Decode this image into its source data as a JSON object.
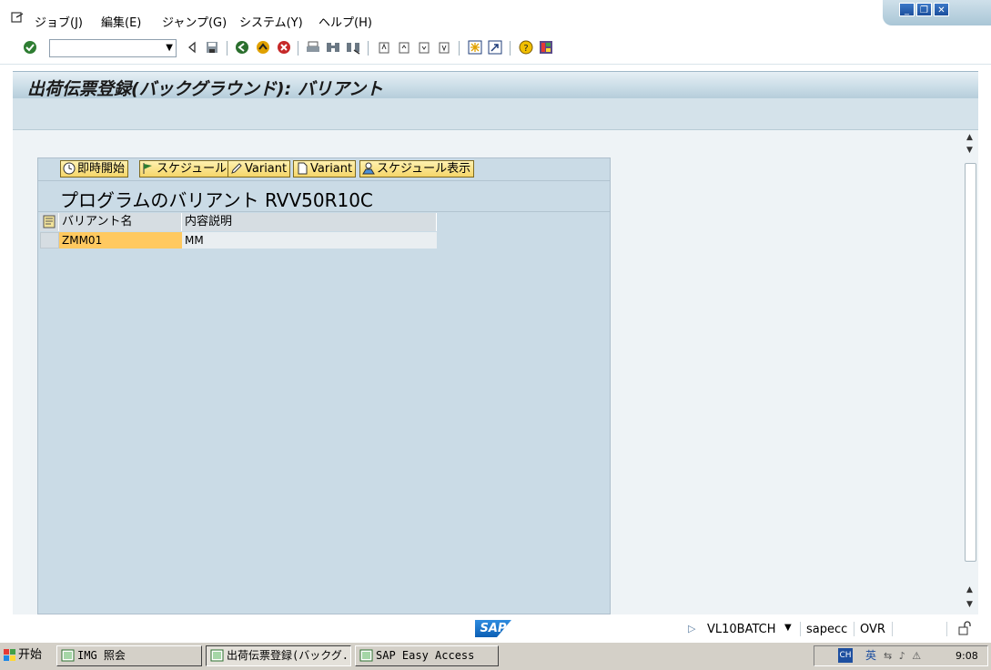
{
  "menu": {
    "items": [
      "ジョブ(J)",
      "編集(E)",
      "ジャンプ(G)",
      "システム(Y)",
      "ヘルプ(H)"
    ]
  },
  "toolbar": {
    "command_value": "",
    "icons": [
      "enter-icon",
      "back-icon",
      "save-icon",
      "green-back-icon",
      "exit-icon",
      "cancel-icon",
      "print-icon",
      "find-icon",
      "find-next-icon",
      "first-page-icon",
      "prev-page-icon",
      "next-page-icon",
      "last-page-icon",
      "new-session-icon",
      "shortcut-icon",
      "help-icon",
      "layout-icon"
    ]
  },
  "title": "出荷伝票登録(バックグラウンド): バリアント",
  "panel": {
    "buttons": [
      "即時開始",
      "スケジュール",
      "Variant",
      "Variant",
      "スケジュール表示"
    ],
    "heading": "プログラムのバリアント RVV50R10C",
    "table": {
      "columns": [
        "バリアント名",
        "内容説明"
      ],
      "rows": [
        {
          "name": "ZMM01",
          "description": "MM"
        }
      ]
    }
  },
  "status": {
    "logo": "SAP",
    "transaction": "VL10BATCH",
    "server": "sapecc",
    "mode": "OVR"
  },
  "taskbar": {
    "start": "开始",
    "tasks": [
      "IMG 照会",
      "出荷伝票登録(バックグ...",
      "SAP Easy Access"
    ],
    "tray_lang": "英",
    "time": "9:08"
  },
  "colors": {
    "title_bg": "#c8dbe6",
    "panel_bg": "#cadbe6",
    "button_bg": "#f5d66a",
    "selected_cell": "#ffc960",
    "sap_blue": "#0b5fb4"
  }
}
